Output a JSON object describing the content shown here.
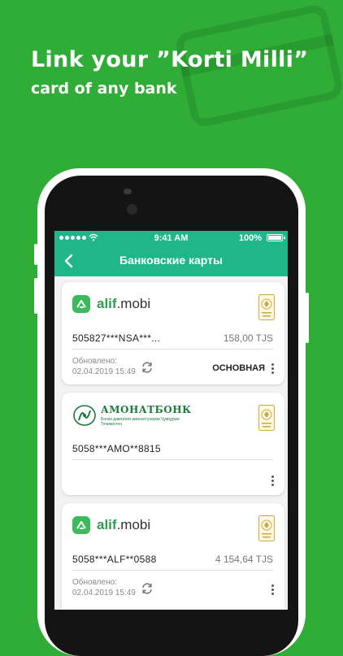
{
  "promo": {
    "headline": "Link your ”Korti Milli”",
    "subheadline": "card of any bank"
  },
  "status_bar": {
    "time": "9:41 AM",
    "battery": "100%"
  },
  "nav": {
    "title": "Банковские карты"
  },
  "cards": [
    {
      "bank_brand": "alif",
      "bank_suffix": ".mobi",
      "number": "505827***NSA***...",
      "balance": "158,00 TJS",
      "updated_label": "Обновлено:",
      "updated_date": "02.04.2019 15:49",
      "status": "ОСНОВНАЯ"
    },
    {
      "bank_name": "АМОНАТБОНК",
      "bank_subtitle": "Бонки давлатии амонатгузории Ҷумҳурии Тоҷикистон",
      "number": "5058***AMO**8815"
    },
    {
      "bank_brand": "alif",
      "bank_suffix": ".mobi",
      "number": "5058***ALF**0588",
      "balance": "4 154,64 TJS",
      "updated_label": "Обновлено:",
      "updated_date": "02.04.2019 15:49"
    }
  ],
  "colors": {
    "background": "#2fad36",
    "header": "#1fb68a",
    "alif_green": "#3dba5b",
    "amonat_green": "#1e7a3c"
  }
}
